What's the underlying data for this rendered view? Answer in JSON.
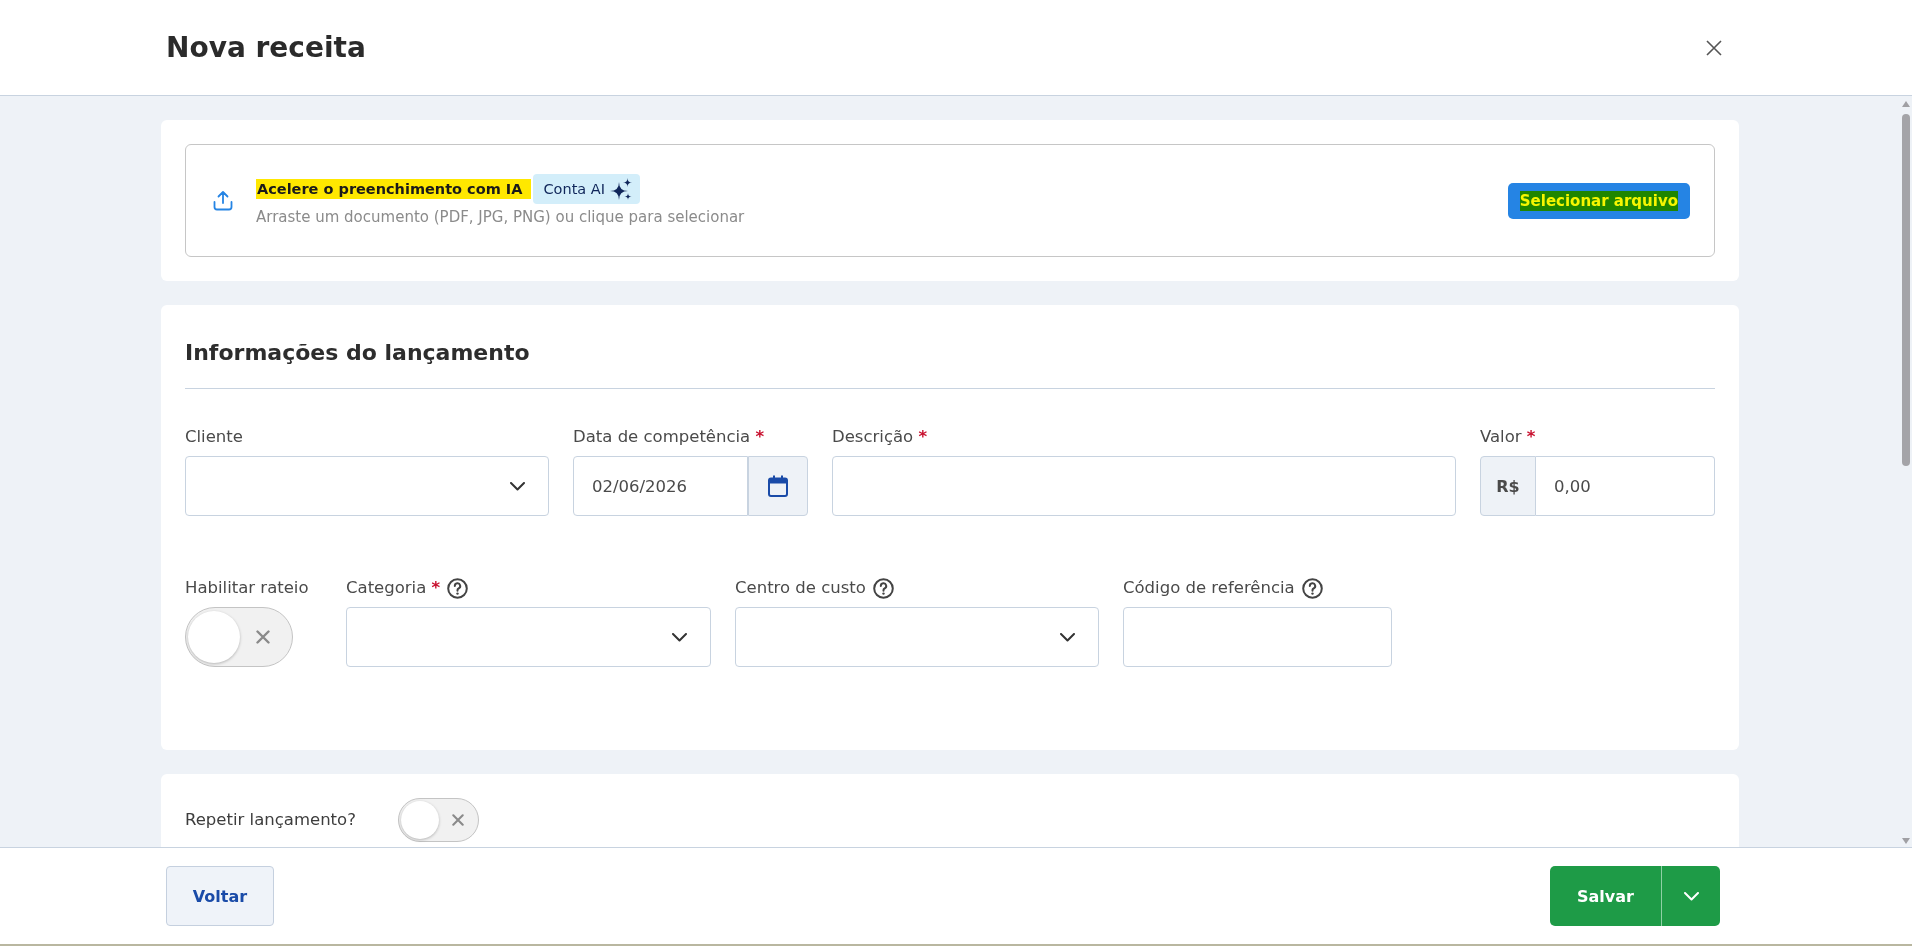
{
  "dialog": {
    "title": "Nova receita"
  },
  "upload": {
    "title": "Acelere o preenchimento com IA",
    "badge": "Conta AI",
    "hint": "Arraste um documento (PDF, JPG, PNG) ou clique para selecionar",
    "button": "Selecionar arquivo"
  },
  "section": {
    "title": "Informações do lançamento",
    "rows": [
      [
        {
          "kind": "select",
          "label": "Cliente"
        },
        {
          "kind": "date",
          "label": "Data de competência",
          "required_mark": "*",
          "value": "02/06/2026"
        },
        {
          "kind": "text",
          "label": "Descrição",
          "required_mark": "*"
        },
        {
          "kind": "currency",
          "label": "Valor",
          "required_mark": "*",
          "prefix": "R$",
          "value": "0,00"
        }
      ],
      [
        {
          "kind": "toggle",
          "label": "Habilitar rateio",
          "on": false
        },
        {
          "kind": "select",
          "label": "Categoria",
          "required_mark": "*",
          "help": true
        },
        {
          "kind": "select",
          "label": "Centro de custo",
          "help": true
        },
        {
          "kind": "text",
          "label": "Código de referência",
          "help": true
        }
      ]
    ]
  },
  "repeat": {
    "label": "Repetir lançamento?",
    "on": false
  },
  "footer": {
    "back": "Voltar",
    "save": "Salvar"
  }
}
